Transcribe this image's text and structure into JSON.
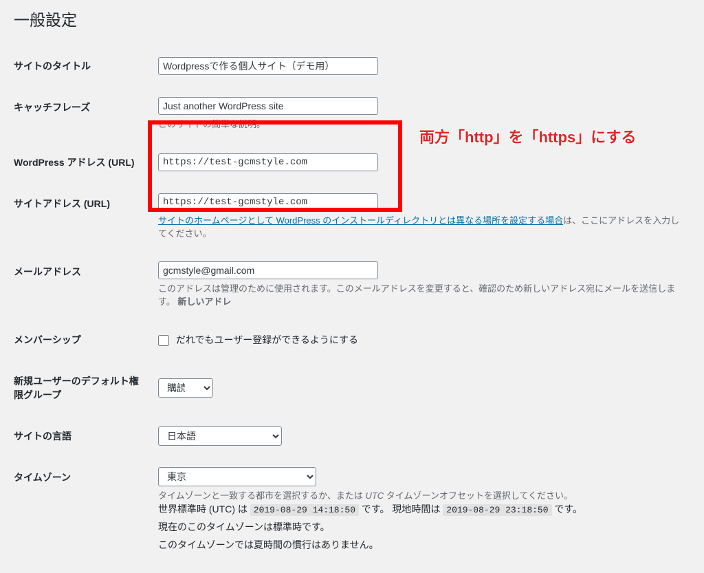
{
  "page_title": "一般設定",
  "fields": {
    "site_title": {
      "label": "サイトのタイトル",
      "value": "Wordpressで作る個人サイト（デモ用）"
    },
    "tagline": {
      "label": "キャッチフレーズ",
      "value": "Just another WordPress site",
      "desc": "このサイトの簡単な説明。"
    },
    "wp_url": {
      "label": "WordPress アドレス (URL)",
      "value": "https://test-gcmstyle.com"
    },
    "site_url": {
      "label": "サイトアドレス (URL)",
      "value": "https://test-gcmstyle.com",
      "desc_link": "サイトのホームページとして WordPress のインストールディレクトリとは異なる場所を設定する場合",
      "desc_tail": "は、ここにアドレスを入力してください。"
    },
    "email": {
      "label": "メールアドレス",
      "value": "gcmstyle@gmail.com",
      "desc_part1": "このアドレスは管理のために使用されます。このメールアドレスを変更すると、確認のため新しいアドレス宛にメールを送信します。",
      "desc_bold": "新しいアドレ"
    },
    "membership": {
      "label": "メンバーシップ",
      "checkbox_label": "だれでもユーザー登録ができるようにする"
    },
    "default_role": {
      "label": "新規ユーザーのデフォルト権限グループ",
      "value": "購読者"
    },
    "site_lang": {
      "label": "サイトの言語",
      "value": "日本語"
    },
    "timezone": {
      "label": "タイムゾーン",
      "value": "東京",
      "desc1_a": "タイムゾーンと一致する都市を選択するか、または ",
      "desc1_i": "UTC",
      "desc1_b": " タイムゾーンオフセットを選択してください。",
      "utc_label": "世界標準時 (UTC) は",
      "utc_time": "2019-08-29 14:18:50",
      "mid_text": "です。 現地時間は",
      "local_time": "2019-08-29 23:18:50",
      "tail_text": "です。",
      "line3": "現在のこのタイムゾーンは標準時です。",
      "line4": "このタイムゾーンでは夏時間の慣行はありません。"
    }
  },
  "annotation": "両方「http」を「https」にする"
}
